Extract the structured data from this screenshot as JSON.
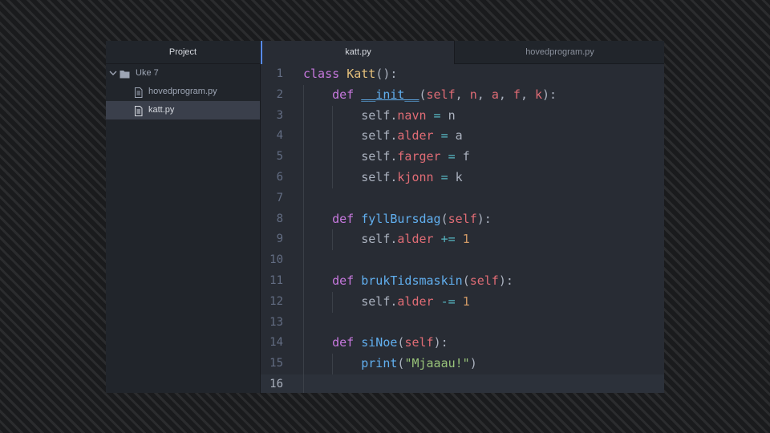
{
  "tree": {
    "header": "Project",
    "folder": "Uke 7",
    "files": [
      "hovedprogram.py",
      "katt.py"
    ],
    "selected_file": "katt.py"
  },
  "tabs": [
    {
      "label": "katt.py",
      "active": true
    },
    {
      "label": "hovedprogram.py",
      "active": false
    }
  ],
  "editor": {
    "current_line": 16,
    "lines": [
      {
        "n": "1",
        "tokens": [
          {
            "t": "class",
            "c": "kw"
          },
          {
            "t": " ",
            "c": "punc"
          },
          {
            "t": "Katt",
            "c": "cls"
          },
          {
            "t": "():",
            "c": "punc"
          }
        ]
      },
      {
        "n": "2",
        "tokens": [
          {
            "t": "    ",
            "c": "punc"
          },
          {
            "t": "def",
            "c": "kw"
          },
          {
            "t": " ",
            "c": "punc"
          },
          {
            "t": "__init__",
            "c": "fnu"
          },
          {
            "t": "(",
            "c": "punc"
          },
          {
            "t": "self",
            "c": "param"
          },
          {
            "t": ", ",
            "c": "punc"
          },
          {
            "t": "n",
            "c": "param"
          },
          {
            "t": ", ",
            "c": "punc"
          },
          {
            "t": "a",
            "c": "param"
          },
          {
            "t": ", ",
            "c": "punc"
          },
          {
            "t": "f",
            "c": "param"
          },
          {
            "t": ", ",
            "c": "punc"
          },
          {
            "t": "k",
            "c": "param"
          },
          {
            "t": "):",
            "c": "punc"
          }
        ]
      },
      {
        "n": "3",
        "tokens": [
          {
            "t": "        ",
            "c": "punc"
          },
          {
            "t": "self",
            "c": "self"
          },
          {
            "t": ".",
            "c": "punc"
          },
          {
            "t": "navn",
            "c": "prop"
          },
          {
            "t": " = ",
            "c": "op"
          },
          {
            "t": "n",
            "c": "punc"
          }
        ]
      },
      {
        "n": "4",
        "tokens": [
          {
            "t": "        ",
            "c": "punc"
          },
          {
            "t": "self",
            "c": "self"
          },
          {
            "t": ".",
            "c": "punc"
          },
          {
            "t": "alder",
            "c": "prop"
          },
          {
            "t": " = ",
            "c": "op"
          },
          {
            "t": "a",
            "c": "punc"
          }
        ]
      },
      {
        "n": "5",
        "tokens": [
          {
            "t": "        ",
            "c": "punc"
          },
          {
            "t": "self",
            "c": "self"
          },
          {
            "t": ".",
            "c": "punc"
          },
          {
            "t": "farger",
            "c": "prop"
          },
          {
            "t": " = ",
            "c": "op"
          },
          {
            "t": "f",
            "c": "punc"
          }
        ]
      },
      {
        "n": "6",
        "tokens": [
          {
            "t": "        ",
            "c": "punc"
          },
          {
            "t": "self",
            "c": "self"
          },
          {
            "t": ".",
            "c": "punc"
          },
          {
            "t": "kjonn",
            "c": "prop"
          },
          {
            "t": " = ",
            "c": "op"
          },
          {
            "t": "k",
            "c": "punc"
          }
        ]
      },
      {
        "n": "7",
        "tokens": []
      },
      {
        "n": "8",
        "tokens": [
          {
            "t": "    ",
            "c": "punc"
          },
          {
            "t": "def",
            "c": "kw"
          },
          {
            "t": " ",
            "c": "punc"
          },
          {
            "t": "fyllBursdag",
            "c": "fn"
          },
          {
            "t": "(",
            "c": "punc"
          },
          {
            "t": "self",
            "c": "param"
          },
          {
            "t": "):",
            "c": "punc"
          }
        ]
      },
      {
        "n": "9",
        "tokens": [
          {
            "t": "        ",
            "c": "punc"
          },
          {
            "t": "self",
            "c": "self"
          },
          {
            "t": ".",
            "c": "punc"
          },
          {
            "t": "alder",
            "c": "prop"
          },
          {
            "t": " += ",
            "c": "op"
          },
          {
            "t": "1",
            "c": "num"
          }
        ]
      },
      {
        "n": "10",
        "tokens": []
      },
      {
        "n": "11",
        "tokens": [
          {
            "t": "    ",
            "c": "punc"
          },
          {
            "t": "def",
            "c": "kw"
          },
          {
            "t": " ",
            "c": "punc"
          },
          {
            "t": "brukTidsmaskin",
            "c": "fn"
          },
          {
            "t": "(",
            "c": "punc"
          },
          {
            "t": "self",
            "c": "param"
          },
          {
            "t": "):",
            "c": "punc"
          }
        ]
      },
      {
        "n": "12",
        "tokens": [
          {
            "t": "        ",
            "c": "punc"
          },
          {
            "t": "self",
            "c": "self"
          },
          {
            "t": ".",
            "c": "punc"
          },
          {
            "t": "alder",
            "c": "prop"
          },
          {
            "t": " -= ",
            "c": "op"
          },
          {
            "t": "1",
            "c": "num"
          }
        ]
      },
      {
        "n": "13",
        "tokens": []
      },
      {
        "n": "14",
        "tokens": [
          {
            "t": "    ",
            "c": "punc"
          },
          {
            "t": "def",
            "c": "kw"
          },
          {
            "t": " ",
            "c": "punc"
          },
          {
            "t": "siNoe",
            "c": "fn"
          },
          {
            "t": "(",
            "c": "punc"
          },
          {
            "t": "self",
            "c": "param"
          },
          {
            "t": "):",
            "c": "punc"
          }
        ]
      },
      {
        "n": "15",
        "tokens": [
          {
            "t": "        ",
            "c": "punc"
          },
          {
            "t": "print",
            "c": "fn"
          },
          {
            "t": "(",
            "c": "punc"
          },
          {
            "t": "\"Mjaaau!\"",
            "c": "str"
          },
          {
            "t": ")",
            "c": "punc"
          }
        ]
      },
      {
        "n": "16",
        "tokens": []
      }
    ]
  }
}
